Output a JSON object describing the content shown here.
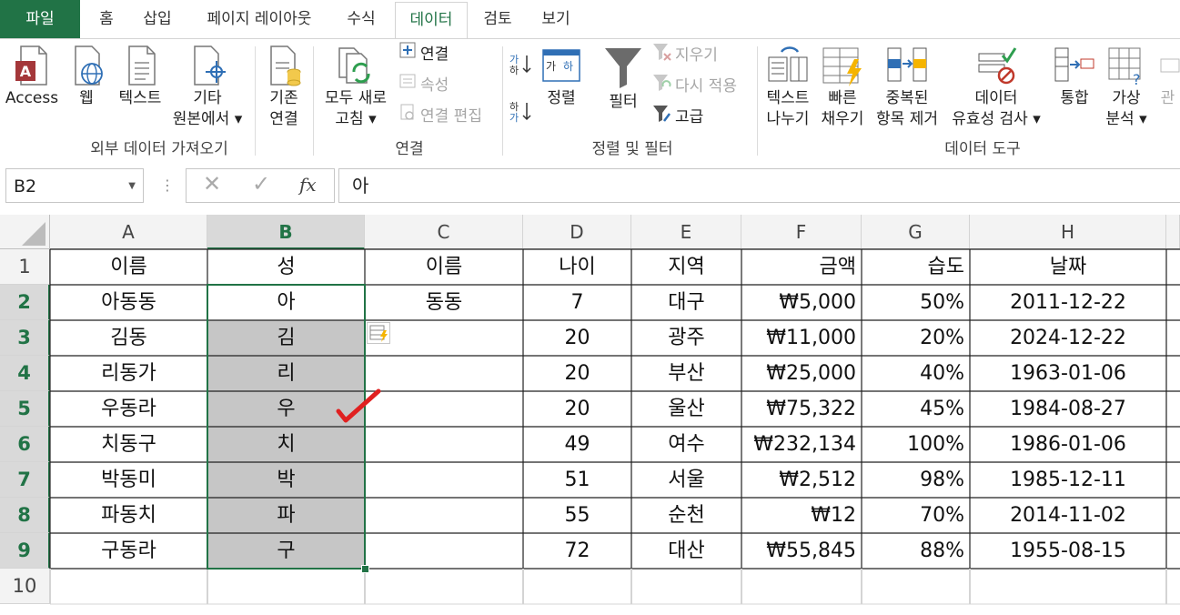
{
  "tabs": [
    {
      "label": "파일",
      "state": "file"
    },
    {
      "label": "홈",
      "state": ""
    },
    {
      "label": "삽입",
      "state": ""
    },
    {
      "label": "페이지 레이아웃",
      "state": ""
    },
    {
      "label": "수식",
      "state": ""
    },
    {
      "label": "데이터",
      "state": "active"
    },
    {
      "label": "검토",
      "state": ""
    },
    {
      "label": "보기",
      "state": ""
    }
  ],
  "ribbon": {
    "external": {
      "group_label": "외부 데이터 가져오기",
      "access": "Access",
      "web": "웹",
      "text": "텍스트",
      "other_line1": "기타",
      "other_line2": "원본에서 ▾"
    },
    "connections": {
      "group_label": "연결",
      "existing_line1": "기존",
      "existing_line2": "연결",
      "refresh_line1": "모두 새로",
      "refresh_line2": "고침 ▾",
      "connections": "연결",
      "properties": "속성",
      "edit_links": "연결 편집"
    },
    "sortfilter": {
      "group_label": "정렬 및 필터",
      "sort": "정렬",
      "filter": "필터",
      "clear": "지우기",
      "reapply": "다시 적용",
      "advanced": "고급"
    },
    "datatools": {
      "group_label": "데이터 도구",
      "text_to_cols_line1": "텍스트",
      "text_to_cols_line2": "나누기",
      "flash_line1": "빠른",
      "flash_line2": "채우기",
      "dup_line1": "중복된",
      "dup_line2": "항목 제거",
      "valid_line1": "데이터",
      "valid_line2": "유효성 검사 ▾",
      "consolidate": "통합",
      "whatif_line1": "가상",
      "whatif_line2": "분석 ▾",
      "partial": "관"
    }
  },
  "formula_bar": {
    "name_box": "B2",
    "cancel": "✕",
    "enter": "✓",
    "fx": "fx",
    "content": "아"
  },
  "columns": [
    "A",
    "B",
    "C",
    "D",
    "E",
    "F",
    "G",
    "H"
  ],
  "selected_column": "B",
  "rows": [
    {
      "num": "1",
      "cells": [
        "이름",
        "성",
        "이름",
        "나이",
        "지역",
        "금액",
        "습도",
        "날짜"
      ]
    },
    {
      "num": "2",
      "cells": [
        "아동동",
        "아",
        "동동",
        "7",
        "대구",
        "₩5,000",
        "50%",
        "2011-12-22"
      ]
    },
    {
      "num": "3",
      "cells": [
        "김동",
        "김",
        "",
        "20",
        "광주",
        "₩11,000",
        "20%",
        "2024-12-22"
      ]
    },
    {
      "num": "4",
      "cells": [
        "리동가",
        "리",
        "",
        "20",
        "부산",
        "₩25,000",
        "40%",
        "1963-01-06"
      ]
    },
    {
      "num": "5",
      "cells": [
        "우동라",
        "우",
        "",
        "20",
        "울산",
        "₩75,322",
        "45%",
        "1984-08-27"
      ]
    },
    {
      "num": "6",
      "cells": [
        "치동구",
        "치",
        "",
        "49",
        "여수",
        "₩232,134",
        "100%",
        "1986-01-06"
      ]
    },
    {
      "num": "7",
      "cells": [
        "박동미",
        "박",
        "",
        "51",
        "서울",
        "₩2,512",
        "98%",
        "1985-12-11"
      ]
    },
    {
      "num": "8",
      "cells": [
        "파동치",
        "파",
        "",
        "55",
        "순천",
        "₩12",
        "70%",
        "2014-11-02"
      ]
    },
    {
      "num": "9",
      "cells": [
        "구동라",
        "구",
        "",
        "72",
        "대산",
        "₩55,845",
        "88%",
        "1955-08-15"
      ]
    },
    {
      "num": "10",
      "cells": [
        "",
        "",
        "",
        "",
        "",
        "",
        "",
        ""
      ]
    }
  ],
  "colors": {
    "excel_green": "#217346",
    "selection_fill": "#c6c6c6",
    "check_mark": "#e02020"
  }
}
